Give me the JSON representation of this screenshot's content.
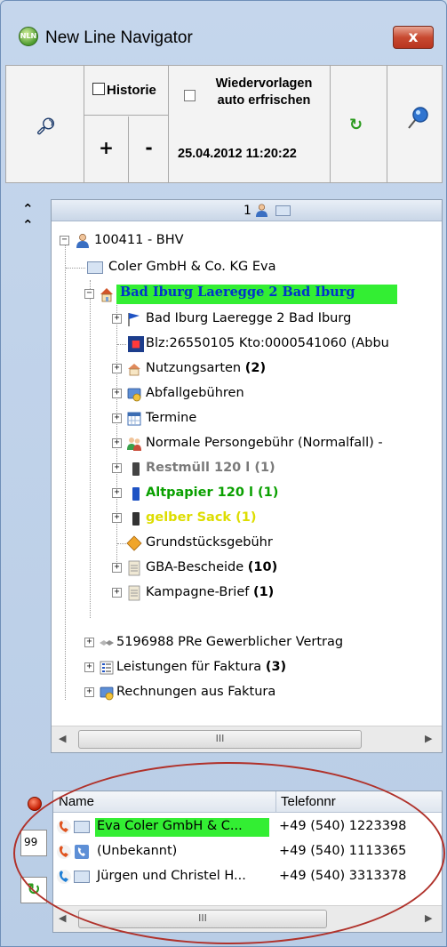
{
  "window": {
    "title": "New Line Navigator",
    "close_glyph": "x",
    "app_icon": "NLN"
  },
  "toolbar": {
    "historie_label": "Historie",
    "plus_label": "+",
    "minus_label": "-",
    "wiedervorlagen_label_line1": "Wiedervorlagen",
    "wiedervorlagen_label_line2": "auto erfrischen",
    "datetime": "25.04.2012 11:20:22"
  },
  "tree": {
    "header_count": "1",
    "items": [
      {
        "label": "100411 - BHV"
      },
      {
        "label": "Coler GmbH & Co. KG Eva"
      },
      {
        "label": "Bad Iburg Laeregge    2 Bad Iburg"
      },
      {
        "label": "Bad Iburg Laeregge 2  Bad Iburg"
      },
      {
        "label": "Blz:26550105  Kto:0000541060 (Abbu"
      },
      {
        "label": "Nutzungsarten",
        "count": "(2)"
      },
      {
        "label": "Abfallgebühren"
      },
      {
        "label": "Termine"
      },
      {
        "label": "Normale Persongebühr (Normalfall) -"
      },
      {
        "label": "Restmüll 120 l",
        "count": "(1)"
      },
      {
        "label": "Altpapier 120 l",
        "count": "(1)"
      },
      {
        "label": "gelber Sack",
        "count": "(1)"
      },
      {
        "label": "Grundstücksgebühr"
      },
      {
        "label": "GBA-Bescheide",
        "count": "(10)"
      },
      {
        "label": "Kampagne-Brief",
        "count": "(1)"
      },
      {
        "label": "5196988 PRe  Gewerblicher Vertrag"
      },
      {
        "label": "Leistungen für Faktura",
        "count": "(3)"
      },
      {
        "label": "Rechnungen aus Faktura"
      }
    ],
    "scroll_thumb": "III"
  },
  "contacts": {
    "columns": {
      "name": "Name",
      "tel": "Telefonnr"
    },
    "rows": [
      {
        "name": "Eva Coler GmbH & C...",
        "tel": "+49 (540) 1223398"
      },
      {
        "name": "(Unbekannt)",
        "tel": "+49 (540) 1113365"
      },
      {
        "name": "Jürgen und Christel H...",
        "tel": "+49 (540) 3313378"
      }
    ],
    "side_count": "99",
    "scroll_thumb": "III"
  },
  "colors": {
    "highlight_green": "#33ee33",
    "bold_green": "#0aa000",
    "grey": "#7a7a7a",
    "yellow": "#dddd00",
    "ellipse": "#b0322b"
  }
}
